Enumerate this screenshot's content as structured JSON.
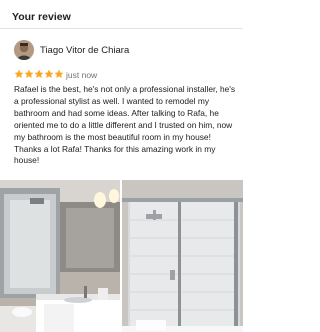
{
  "header": {
    "title": "Your review"
  },
  "review": {
    "reviewer_name": "Tiago Vitor de Chiara",
    "rating": 5,
    "rating_max": 5,
    "time": "just now",
    "text": "Rafael is the best, he's not only a professional installer, he's a professional stylist as well. I wanted to remodel my bathroom and had some ideas. After talking to Rafa, he oriented me to do a little different and I trusted on him, now my bathroom is the most beautiful room in my house! Thanks a lot Rafa! Thanks for this amazing work in my house!",
    "photo_count": 2
  },
  "colors": {
    "star": "#f9a825",
    "meta_text": "#70757a",
    "text": "#202124"
  },
  "icons": [
    "avatar-photo",
    "star-icon"
  ]
}
